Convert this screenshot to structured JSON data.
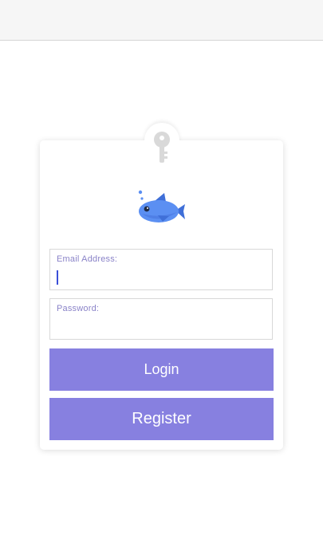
{
  "login_form": {
    "email_label": "Email Address:",
    "email_value": "",
    "password_label": "Password:",
    "password_value": "",
    "login_label": "Login",
    "register_label": "Register"
  },
  "icons": {
    "badge": "key-icon",
    "logo": "fish-icon"
  },
  "colors": {
    "button": "#8780e0",
    "label": "#8a83c8",
    "caret": "#3a4fd8",
    "fish": "#5b8ff2"
  }
}
